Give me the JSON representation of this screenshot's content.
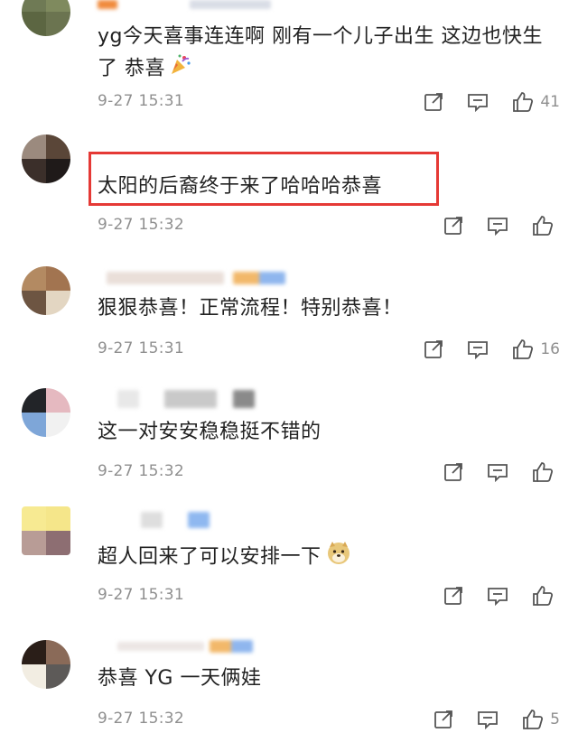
{
  "comments": [
    {
      "text": "yg今天喜事连连啊 刚有一个儿子出生 这边也快生了 恭喜",
      "time": "9-27 15:31",
      "likes": "41",
      "emoji": "party-popper"
    },
    {
      "text": "太阳的后裔终于来了哈哈哈恭喜",
      "time": "9-27 15:32",
      "likes": "",
      "highlighted": true
    },
    {
      "text": "狠狠恭喜！正常流程！特别恭喜！",
      "time": "9-27 15:31",
      "likes": "16"
    },
    {
      "text": "这一对安安稳稳挺不错的",
      "time": "9-27 15:32",
      "likes": ""
    },
    {
      "text": "超人回来了可以安排一下",
      "time": "9-27 15:31",
      "likes": "",
      "emoji": "doge"
    },
    {
      "text": "恭喜 YG 一天俩娃",
      "time": "9-27 15:32",
      "likes": "5"
    }
  ],
  "colors": {
    "highlight_border": "#e53935",
    "text": "#222222",
    "meta": "#8f8f8f"
  },
  "icons": [
    "share-icon",
    "comment-icon",
    "like-icon"
  ]
}
